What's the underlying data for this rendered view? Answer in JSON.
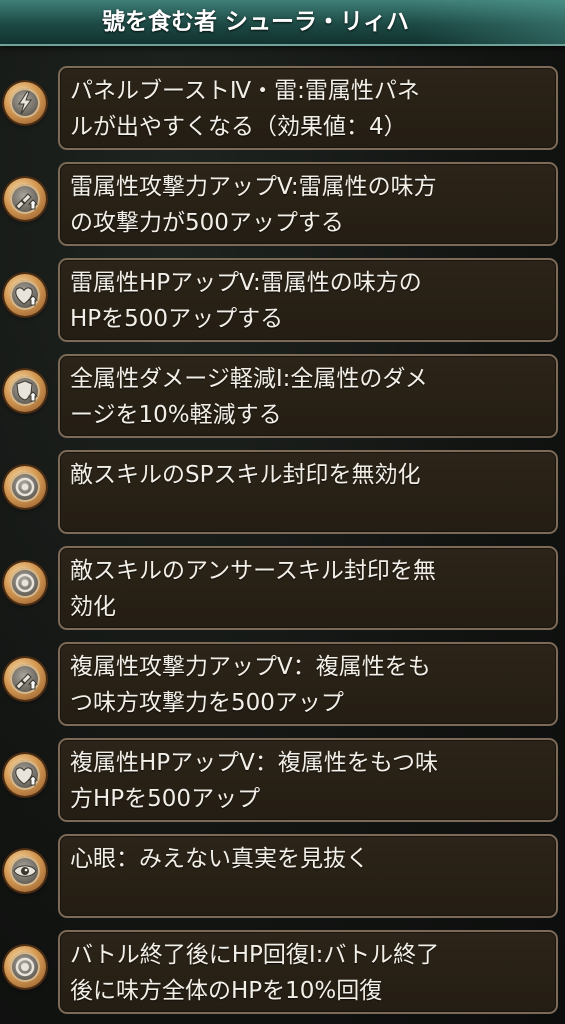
{
  "header": {
    "title": "號を食む者 シューラ・リィハ"
  },
  "skills": [
    {
      "icon": "lightning-panel-icon",
      "text": "パネルブーストⅣ・雷:雷属性パネ\nルが出やすくなる（効果値：4）"
    },
    {
      "icon": "sword-up-icon",
      "text": "雷属性攻撃力アップV:雷属性の味方\nの攻撃力が500アップする"
    },
    {
      "icon": "heart-up-icon",
      "text": "雷属性HPアップV:雷属性の味方の\nHPを500アップする"
    },
    {
      "icon": "shield-up-icon",
      "text": "全属性ダメージ軽減I:全属性のダメ\nージを10%軽減する"
    },
    {
      "icon": "seal-icon",
      "text": "敵スキルのSPスキル封印を無効化"
    },
    {
      "icon": "seal-icon",
      "text": "敵スキルのアンサースキル封印を無\n効化"
    },
    {
      "icon": "sword-up-icon",
      "text": "複属性攻撃力アップV：複属性をも\nつ味方攻撃力を500アップ"
    },
    {
      "icon": "heart-up-icon",
      "text": "複属性HPアップV：複属性をもつ味\n方HPを500アップ"
    },
    {
      "icon": "eye-icon",
      "text": "心眼：みえない真実を見抜く"
    },
    {
      "icon": "heal-icon",
      "text": "バトル終了後にHP回復I:バトル終了\n後に味方全体のHPを10%回復"
    }
  ]
}
